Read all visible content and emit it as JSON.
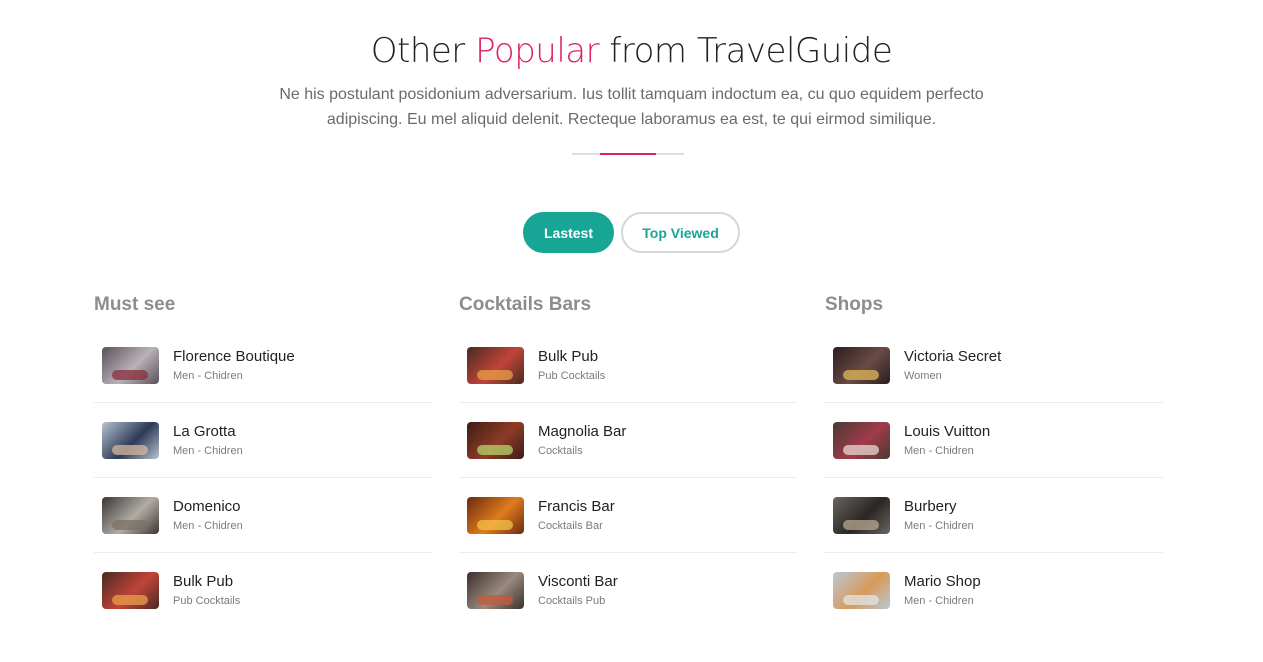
{
  "header": {
    "title_part1": "Other ",
    "title_accent": "Popular",
    "title_part2": " from TravelGuide",
    "subtitle": "Ne his postulant posidonium adversarium. Ius tollit tamquam indoctum ea, cu quo equidem perfecto adipiscing. Eu mel aliquid delenit. Recteque laboramus ea est, te qui eirmod similique."
  },
  "tabs": [
    {
      "label": "Lastest",
      "active": true
    },
    {
      "label": "Top Viewed",
      "active": false
    }
  ],
  "columns": [
    {
      "title": "Must see",
      "items": [
        {
          "name": "Florence Boutique",
          "sub": "Men - Chidren",
          "thumb": [
            "#5a4f5b",
            "#b9b2b8",
            "#8a2d3a"
          ]
        },
        {
          "name": "La Grotta",
          "sub": "Men - Chidren",
          "thumb": [
            "#b7c3cf",
            "#2c3a56",
            "#d7b79e"
          ]
        },
        {
          "name": "Domenico",
          "sub": "Men - Chidren",
          "thumb": [
            "#3a3634",
            "#b2aca5",
            "#7a6f66"
          ]
        },
        {
          "name": "Bulk Pub",
          "sub": "Pub Cocktails",
          "thumb": [
            "#4a2a22",
            "#c0443a",
            "#e8a04a"
          ]
        }
      ]
    },
    {
      "title": "Cocktails Bars",
      "items": [
        {
          "name": "Bulk Pub",
          "sub": "Pub Cocktails",
          "thumb": [
            "#4a2a22",
            "#c0443a",
            "#e8a04a"
          ]
        },
        {
          "name": "Magnolia Bar",
          "sub": "Cocktails",
          "thumb": [
            "#3d1d15",
            "#8e3b26",
            "#b7d46a"
          ]
        },
        {
          "name": "Francis Bar",
          "sub": "Cocktails Bar",
          "thumb": [
            "#6a2a0e",
            "#e07c1c",
            "#f4c04a"
          ]
        },
        {
          "name": "Visconti Bar",
          "sub": "Cocktails Pub",
          "thumb": [
            "#3a302c",
            "#9a8a7e",
            "#c45a3a"
          ]
        }
      ]
    },
    {
      "title": "Shops",
      "items": [
        {
          "name": "Victoria Secret",
          "sub": "Women",
          "thumb": [
            "#2a1e1e",
            "#6a4a44",
            "#e0b85a"
          ]
        },
        {
          "name": "Louis Vuitton",
          "sub": "Men - Chidren",
          "thumb": [
            "#4a3a34",
            "#a23a4a",
            "#e8d8d0"
          ]
        },
        {
          "name": "Burbery",
          "sub": "Men - Chidren",
          "thumb": [
            "#6a6560",
            "#2a2624",
            "#b8a890"
          ]
        },
        {
          "name": "Mario Shop",
          "sub": "Men - Chidren",
          "thumb": [
            "#b8c8d4",
            "#d89a5a",
            "#e0e4e8"
          ]
        }
      ]
    }
  ],
  "colors": {
    "accent": "#e0205f",
    "teal": "#17a596",
    "heading_gray": "#8d8d8d"
  }
}
